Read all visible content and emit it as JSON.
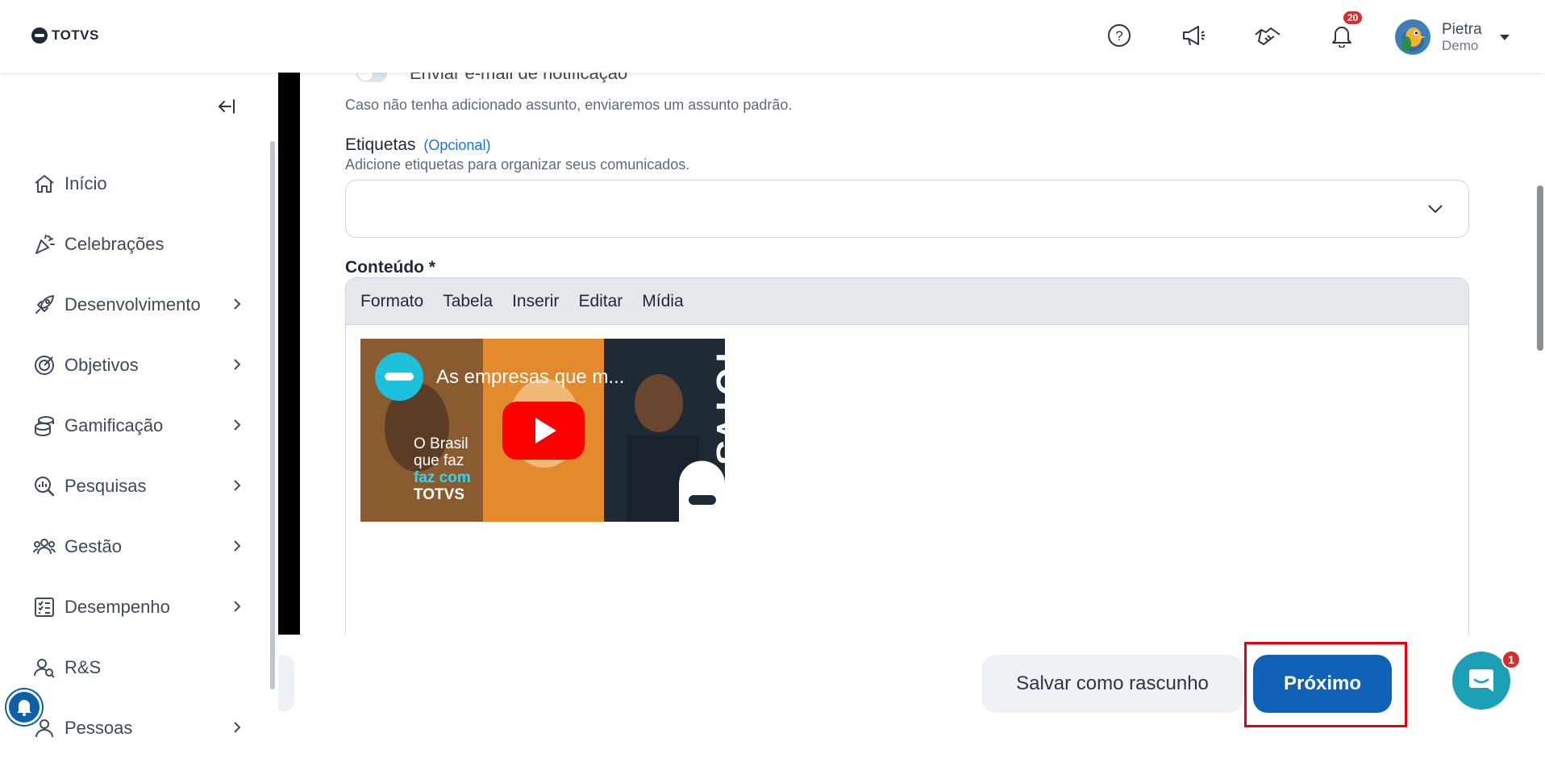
{
  "header": {
    "logo_text": "TOTVS",
    "notification_count": "20",
    "user_name": "Pietra",
    "user_role": "Demo"
  },
  "sidebar": {
    "items": [
      {
        "label": "Início",
        "icon": "home-icon",
        "has_chevron": false
      },
      {
        "label": "Celebrações",
        "icon": "party-popper-icon",
        "has_chevron": false
      },
      {
        "label": "Desenvolvimento",
        "icon": "rocket-icon",
        "has_chevron": true
      },
      {
        "label": "Objetivos",
        "icon": "target-icon",
        "has_chevron": true
      },
      {
        "label": "Gamificação",
        "icon": "coins-icon",
        "has_chevron": true
      },
      {
        "label": "Pesquisas",
        "icon": "search-chart-icon",
        "has_chevron": true
      },
      {
        "label": "Gestão",
        "icon": "users-icon",
        "has_chevron": true
      },
      {
        "label": "Desempenho",
        "icon": "checklist-icon",
        "has_chevron": true
      },
      {
        "label": "R&S",
        "icon": "user-search-icon",
        "has_chevron": false
      },
      {
        "label": "Pessoas",
        "icon": "people-icon",
        "has_chevron": true
      }
    ]
  },
  "form": {
    "notify_toggle_label": "Enviar e-mail de notificação",
    "notify_hint": "Caso não tenha adicionado assunto, enviaremos um assunto padrão.",
    "tags_title": "Etiquetas",
    "tags_optional": "(Opcional)",
    "tags_subtitle": "Adicione etiquetas para organizar seus comunicados.",
    "content_title": "Conteúdo *",
    "editor_menu": [
      "Formato",
      "Tabela",
      "Inserir",
      "Editar",
      "Mídia"
    ],
    "video": {
      "title": "As empresas que m...",
      "caption_line1": "O Brasil",
      "caption_line2": "que faz",
      "caption_line3": "faz com",
      "caption_line4": "TOTVS",
      "side_text": "TOTVS"
    }
  },
  "footer": {
    "draft_label": "Salvar como rascunho",
    "next_label": "Próximo",
    "chat_badge": "1"
  },
  "colors": {
    "primary": "#0f62b5",
    "link": "#1a73d9",
    "highlight": "#e3000f",
    "chat": "#1ba0b5",
    "badge": "#d32f2f"
  }
}
